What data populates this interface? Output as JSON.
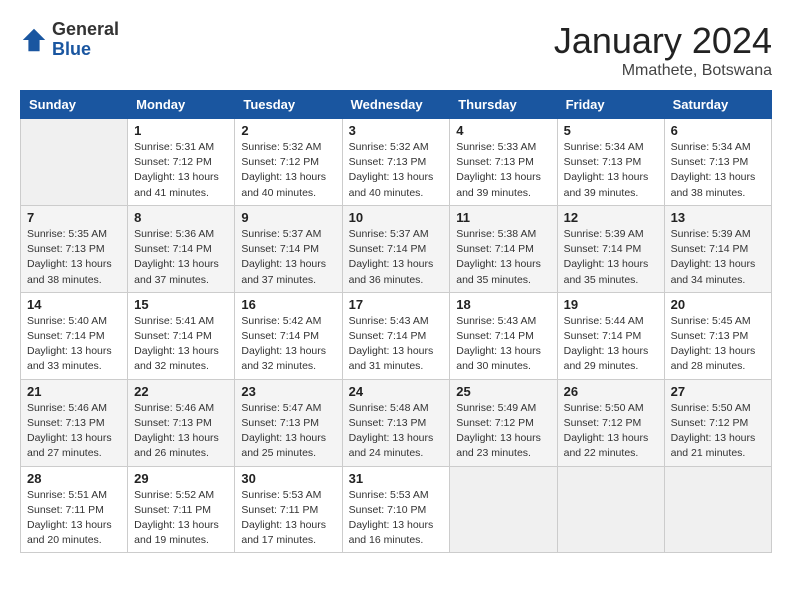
{
  "header": {
    "logo_general": "General",
    "logo_blue": "Blue",
    "month_year": "January 2024",
    "location": "Mmathete, Botswana"
  },
  "columns": [
    "Sunday",
    "Monday",
    "Tuesday",
    "Wednesday",
    "Thursday",
    "Friday",
    "Saturday"
  ],
  "weeks": [
    [
      {
        "day": "",
        "sunrise": "",
        "sunset": "",
        "daylight": ""
      },
      {
        "day": "1",
        "sunrise": "5:31 AM",
        "sunset": "7:12 PM",
        "daylight": "13 hours and 41 minutes."
      },
      {
        "day": "2",
        "sunrise": "5:32 AM",
        "sunset": "7:12 PM",
        "daylight": "13 hours and 40 minutes."
      },
      {
        "day": "3",
        "sunrise": "5:32 AM",
        "sunset": "7:13 PM",
        "daylight": "13 hours and 40 minutes."
      },
      {
        "day": "4",
        "sunrise": "5:33 AM",
        "sunset": "7:13 PM",
        "daylight": "13 hours and 39 minutes."
      },
      {
        "day": "5",
        "sunrise": "5:34 AM",
        "sunset": "7:13 PM",
        "daylight": "13 hours and 39 minutes."
      },
      {
        "day": "6",
        "sunrise": "5:34 AM",
        "sunset": "7:13 PM",
        "daylight": "13 hours and 38 minutes."
      }
    ],
    [
      {
        "day": "7",
        "sunrise": "5:35 AM",
        "sunset": "7:13 PM",
        "daylight": "13 hours and 38 minutes."
      },
      {
        "day": "8",
        "sunrise": "5:36 AM",
        "sunset": "7:14 PM",
        "daylight": "13 hours and 37 minutes."
      },
      {
        "day": "9",
        "sunrise": "5:37 AM",
        "sunset": "7:14 PM",
        "daylight": "13 hours and 37 minutes."
      },
      {
        "day": "10",
        "sunrise": "5:37 AM",
        "sunset": "7:14 PM",
        "daylight": "13 hours and 36 minutes."
      },
      {
        "day": "11",
        "sunrise": "5:38 AM",
        "sunset": "7:14 PM",
        "daylight": "13 hours and 35 minutes."
      },
      {
        "day": "12",
        "sunrise": "5:39 AM",
        "sunset": "7:14 PM",
        "daylight": "13 hours and 35 minutes."
      },
      {
        "day": "13",
        "sunrise": "5:39 AM",
        "sunset": "7:14 PM",
        "daylight": "13 hours and 34 minutes."
      }
    ],
    [
      {
        "day": "14",
        "sunrise": "5:40 AM",
        "sunset": "7:14 PM",
        "daylight": "13 hours and 33 minutes."
      },
      {
        "day": "15",
        "sunrise": "5:41 AM",
        "sunset": "7:14 PM",
        "daylight": "13 hours and 32 minutes."
      },
      {
        "day": "16",
        "sunrise": "5:42 AM",
        "sunset": "7:14 PM",
        "daylight": "13 hours and 32 minutes."
      },
      {
        "day": "17",
        "sunrise": "5:43 AM",
        "sunset": "7:14 PM",
        "daylight": "13 hours and 31 minutes."
      },
      {
        "day": "18",
        "sunrise": "5:43 AM",
        "sunset": "7:14 PM",
        "daylight": "13 hours and 30 minutes."
      },
      {
        "day": "19",
        "sunrise": "5:44 AM",
        "sunset": "7:14 PM",
        "daylight": "13 hours and 29 minutes."
      },
      {
        "day": "20",
        "sunrise": "5:45 AM",
        "sunset": "7:13 PM",
        "daylight": "13 hours and 28 minutes."
      }
    ],
    [
      {
        "day": "21",
        "sunrise": "5:46 AM",
        "sunset": "7:13 PM",
        "daylight": "13 hours and 27 minutes."
      },
      {
        "day": "22",
        "sunrise": "5:46 AM",
        "sunset": "7:13 PM",
        "daylight": "13 hours and 26 minutes."
      },
      {
        "day": "23",
        "sunrise": "5:47 AM",
        "sunset": "7:13 PM",
        "daylight": "13 hours and 25 minutes."
      },
      {
        "day": "24",
        "sunrise": "5:48 AM",
        "sunset": "7:13 PM",
        "daylight": "13 hours and 24 minutes."
      },
      {
        "day": "25",
        "sunrise": "5:49 AM",
        "sunset": "7:12 PM",
        "daylight": "13 hours and 23 minutes."
      },
      {
        "day": "26",
        "sunrise": "5:50 AM",
        "sunset": "7:12 PM",
        "daylight": "13 hours and 22 minutes."
      },
      {
        "day": "27",
        "sunrise": "5:50 AM",
        "sunset": "7:12 PM",
        "daylight": "13 hours and 21 minutes."
      }
    ],
    [
      {
        "day": "28",
        "sunrise": "5:51 AM",
        "sunset": "7:11 PM",
        "daylight": "13 hours and 20 minutes."
      },
      {
        "day": "29",
        "sunrise": "5:52 AM",
        "sunset": "7:11 PM",
        "daylight": "13 hours and 19 minutes."
      },
      {
        "day": "30",
        "sunrise": "5:53 AM",
        "sunset": "7:11 PM",
        "daylight": "13 hours and 17 minutes."
      },
      {
        "day": "31",
        "sunrise": "5:53 AM",
        "sunset": "7:10 PM",
        "daylight": "13 hours and 16 minutes."
      },
      {
        "day": "",
        "sunrise": "",
        "sunset": "",
        "daylight": ""
      },
      {
        "day": "",
        "sunrise": "",
        "sunset": "",
        "daylight": ""
      },
      {
        "day": "",
        "sunrise": "",
        "sunset": "",
        "daylight": ""
      }
    ]
  ]
}
